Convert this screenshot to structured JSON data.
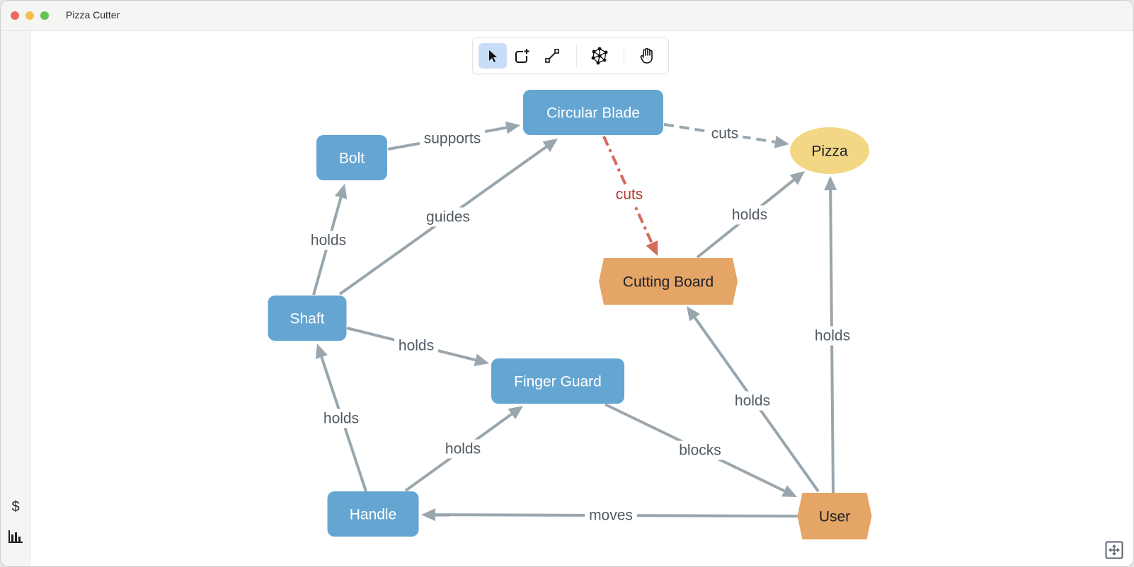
{
  "window": {
    "title": "Pizza Cutter"
  },
  "toolbar": {
    "tools": [
      {
        "id": "select",
        "icon": "pointer-icon",
        "active": true
      },
      {
        "id": "add-node",
        "icon": "add-node-icon",
        "active": false
      },
      {
        "id": "add-edge",
        "icon": "connect-edge-icon",
        "active": false
      },
      {
        "id": "auto-layout",
        "icon": "network-layout-icon",
        "active": false
      },
      {
        "id": "pan",
        "icon": "hand-icon",
        "active": false
      }
    ]
  },
  "sidebar": {
    "items": [
      {
        "id": "cost",
        "icon": "dollar-icon",
        "glyph": "$"
      },
      {
        "id": "stats",
        "icon": "bar-chart-icon"
      }
    ]
  },
  "colors": {
    "component": "#64a5d2",
    "external": "#e4a566",
    "target": "#f3d785",
    "edge": "#9aa6ae",
    "edge_highlight": "#d46a5a",
    "edge_label": "#505a63",
    "edge_label_highlight": "#b83a2a"
  },
  "graph": {
    "nodes": [
      {
        "id": "circular-blade",
        "label": "Circular Blade",
        "kind": "component"
      },
      {
        "id": "bolt",
        "label": "Bolt",
        "kind": "component"
      },
      {
        "id": "shaft",
        "label": "Shaft",
        "kind": "component"
      },
      {
        "id": "finger-guard",
        "label": "Finger Guard",
        "kind": "component"
      },
      {
        "id": "handle",
        "label": "Handle",
        "kind": "component"
      },
      {
        "id": "pizza",
        "label": "Pizza",
        "kind": "target"
      },
      {
        "id": "cutting-board",
        "label": "Cutting Board",
        "kind": "external"
      },
      {
        "id": "user",
        "label": "User",
        "kind": "external"
      }
    ],
    "edges": [
      {
        "from": "bolt",
        "to": "circular-blade",
        "label": "supports",
        "style": "solid"
      },
      {
        "from": "shaft",
        "to": "circular-blade",
        "label": "guides",
        "style": "solid"
      },
      {
        "from": "circular-blade",
        "to": "pizza",
        "label": "cuts",
        "style": "dashed"
      },
      {
        "from": "circular-blade",
        "to": "cutting-board",
        "label": "cuts",
        "style": "dashdot-red"
      },
      {
        "from": "shaft",
        "to": "bolt",
        "label": "holds",
        "style": "solid"
      },
      {
        "from": "cutting-board",
        "to": "pizza",
        "label": "holds",
        "style": "solid"
      },
      {
        "from": "shaft",
        "to": "finger-guard",
        "label": "holds",
        "style": "solid"
      },
      {
        "from": "handle",
        "to": "shaft",
        "label": "holds",
        "style": "solid"
      },
      {
        "from": "handle",
        "to": "finger-guard",
        "label": "holds",
        "style": "solid"
      },
      {
        "from": "finger-guard",
        "to": "user",
        "label": "blocks",
        "style": "solid"
      },
      {
        "from": "user",
        "to": "cutting-board",
        "label": "holds",
        "style": "solid"
      },
      {
        "from": "user",
        "to": "pizza",
        "label": "holds",
        "style": "solid"
      },
      {
        "from": "user",
        "to": "handle",
        "label": "moves",
        "style": "solid"
      }
    ]
  }
}
